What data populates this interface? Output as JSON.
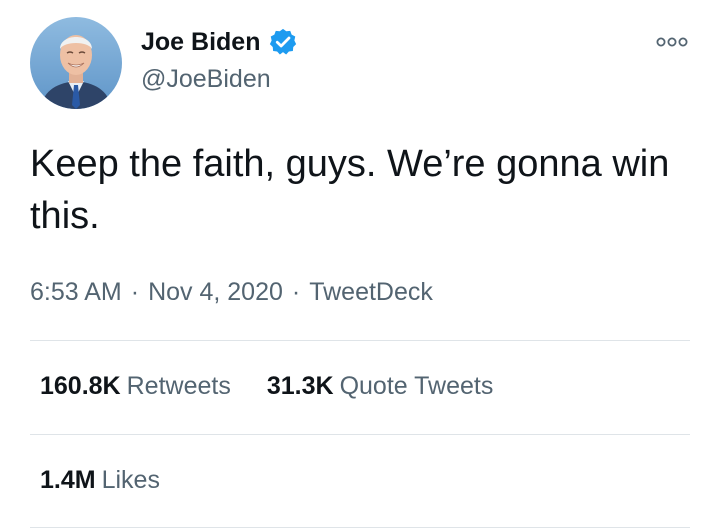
{
  "author": {
    "display_name": "Joe Biden",
    "handle": "@JoeBiden",
    "avatar_icon": "profile-photo",
    "verified_icon": "verified-badge-icon",
    "verified_color": "#1d9bf0"
  },
  "more_icon": "more-options-icon",
  "tweet": {
    "text": "Keep the faith, guys. We’re gonna win this."
  },
  "meta": {
    "time": "6:53 AM",
    "separator": "·",
    "date": "Nov 4, 2020",
    "source": "TweetDeck"
  },
  "stats": {
    "retweets": {
      "count": "160.8K",
      "label": "Retweets"
    },
    "quote_tweets": {
      "count": "31.3K",
      "label": "Quote Tweets"
    },
    "likes": {
      "count": "1.4M",
      "label": "Likes"
    }
  },
  "colors": {
    "text_primary": "#0f1419",
    "text_secondary": "#536471",
    "divider": "#dfe4e8"
  }
}
